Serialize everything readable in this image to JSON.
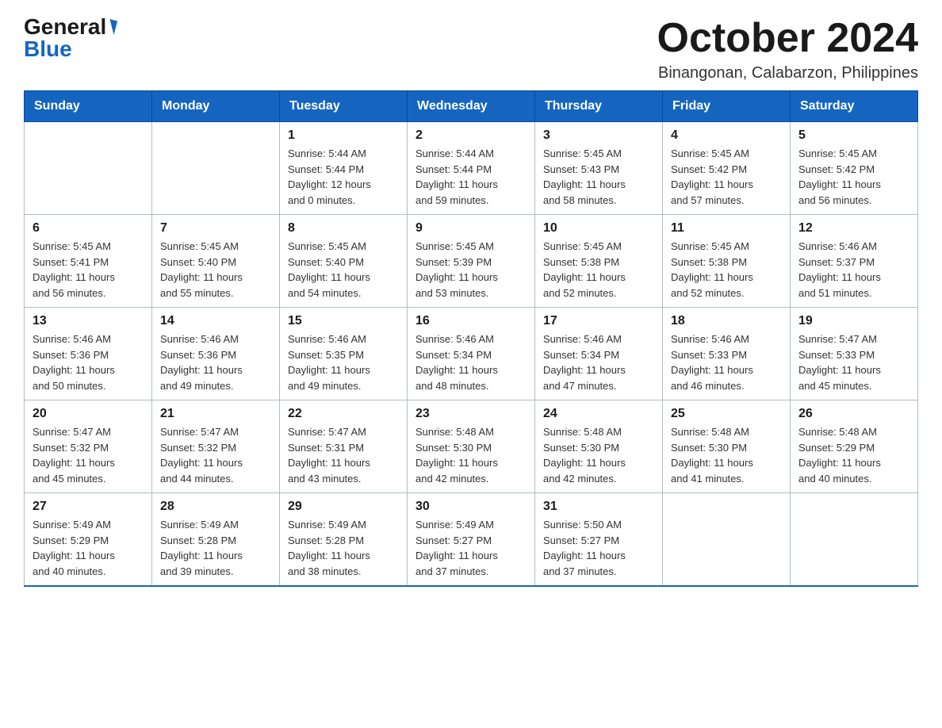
{
  "logo": {
    "general": "General",
    "blue": "Blue"
  },
  "header": {
    "month": "October 2024",
    "location": "Binangonan, Calabarzon, Philippines"
  },
  "weekdays": [
    "Sunday",
    "Monday",
    "Tuesday",
    "Wednesday",
    "Thursday",
    "Friday",
    "Saturday"
  ],
  "weeks": [
    [
      {
        "day": "",
        "info": ""
      },
      {
        "day": "",
        "info": ""
      },
      {
        "day": "1",
        "info": "Sunrise: 5:44 AM\nSunset: 5:44 PM\nDaylight: 12 hours\nand 0 minutes."
      },
      {
        "day": "2",
        "info": "Sunrise: 5:44 AM\nSunset: 5:44 PM\nDaylight: 11 hours\nand 59 minutes."
      },
      {
        "day": "3",
        "info": "Sunrise: 5:45 AM\nSunset: 5:43 PM\nDaylight: 11 hours\nand 58 minutes."
      },
      {
        "day": "4",
        "info": "Sunrise: 5:45 AM\nSunset: 5:42 PM\nDaylight: 11 hours\nand 57 minutes."
      },
      {
        "day": "5",
        "info": "Sunrise: 5:45 AM\nSunset: 5:42 PM\nDaylight: 11 hours\nand 56 minutes."
      }
    ],
    [
      {
        "day": "6",
        "info": "Sunrise: 5:45 AM\nSunset: 5:41 PM\nDaylight: 11 hours\nand 56 minutes."
      },
      {
        "day": "7",
        "info": "Sunrise: 5:45 AM\nSunset: 5:40 PM\nDaylight: 11 hours\nand 55 minutes."
      },
      {
        "day": "8",
        "info": "Sunrise: 5:45 AM\nSunset: 5:40 PM\nDaylight: 11 hours\nand 54 minutes."
      },
      {
        "day": "9",
        "info": "Sunrise: 5:45 AM\nSunset: 5:39 PM\nDaylight: 11 hours\nand 53 minutes."
      },
      {
        "day": "10",
        "info": "Sunrise: 5:45 AM\nSunset: 5:38 PM\nDaylight: 11 hours\nand 52 minutes."
      },
      {
        "day": "11",
        "info": "Sunrise: 5:45 AM\nSunset: 5:38 PM\nDaylight: 11 hours\nand 52 minutes."
      },
      {
        "day": "12",
        "info": "Sunrise: 5:46 AM\nSunset: 5:37 PM\nDaylight: 11 hours\nand 51 minutes."
      }
    ],
    [
      {
        "day": "13",
        "info": "Sunrise: 5:46 AM\nSunset: 5:36 PM\nDaylight: 11 hours\nand 50 minutes."
      },
      {
        "day": "14",
        "info": "Sunrise: 5:46 AM\nSunset: 5:36 PM\nDaylight: 11 hours\nand 49 minutes."
      },
      {
        "day": "15",
        "info": "Sunrise: 5:46 AM\nSunset: 5:35 PM\nDaylight: 11 hours\nand 49 minutes."
      },
      {
        "day": "16",
        "info": "Sunrise: 5:46 AM\nSunset: 5:34 PM\nDaylight: 11 hours\nand 48 minutes."
      },
      {
        "day": "17",
        "info": "Sunrise: 5:46 AM\nSunset: 5:34 PM\nDaylight: 11 hours\nand 47 minutes."
      },
      {
        "day": "18",
        "info": "Sunrise: 5:46 AM\nSunset: 5:33 PM\nDaylight: 11 hours\nand 46 minutes."
      },
      {
        "day": "19",
        "info": "Sunrise: 5:47 AM\nSunset: 5:33 PM\nDaylight: 11 hours\nand 45 minutes."
      }
    ],
    [
      {
        "day": "20",
        "info": "Sunrise: 5:47 AM\nSunset: 5:32 PM\nDaylight: 11 hours\nand 45 minutes."
      },
      {
        "day": "21",
        "info": "Sunrise: 5:47 AM\nSunset: 5:32 PM\nDaylight: 11 hours\nand 44 minutes."
      },
      {
        "day": "22",
        "info": "Sunrise: 5:47 AM\nSunset: 5:31 PM\nDaylight: 11 hours\nand 43 minutes."
      },
      {
        "day": "23",
        "info": "Sunrise: 5:48 AM\nSunset: 5:30 PM\nDaylight: 11 hours\nand 42 minutes."
      },
      {
        "day": "24",
        "info": "Sunrise: 5:48 AM\nSunset: 5:30 PM\nDaylight: 11 hours\nand 42 minutes."
      },
      {
        "day": "25",
        "info": "Sunrise: 5:48 AM\nSunset: 5:30 PM\nDaylight: 11 hours\nand 41 minutes."
      },
      {
        "day": "26",
        "info": "Sunrise: 5:48 AM\nSunset: 5:29 PM\nDaylight: 11 hours\nand 40 minutes."
      }
    ],
    [
      {
        "day": "27",
        "info": "Sunrise: 5:49 AM\nSunset: 5:29 PM\nDaylight: 11 hours\nand 40 minutes."
      },
      {
        "day": "28",
        "info": "Sunrise: 5:49 AM\nSunset: 5:28 PM\nDaylight: 11 hours\nand 39 minutes."
      },
      {
        "day": "29",
        "info": "Sunrise: 5:49 AM\nSunset: 5:28 PM\nDaylight: 11 hours\nand 38 minutes."
      },
      {
        "day": "30",
        "info": "Sunrise: 5:49 AM\nSunset: 5:27 PM\nDaylight: 11 hours\nand 37 minutes."
      },
      {
        "day": "31",
        "info": "Sunrise: 5:50 AM\nSunset: 5:27 PM\nDaylight: 11 hours\nand 37 minutes."
      },
      {
        "day": "",
        "info": ""
      },
      {
        "day": "",
        "info": ""
      }
    ]
  ]
}
